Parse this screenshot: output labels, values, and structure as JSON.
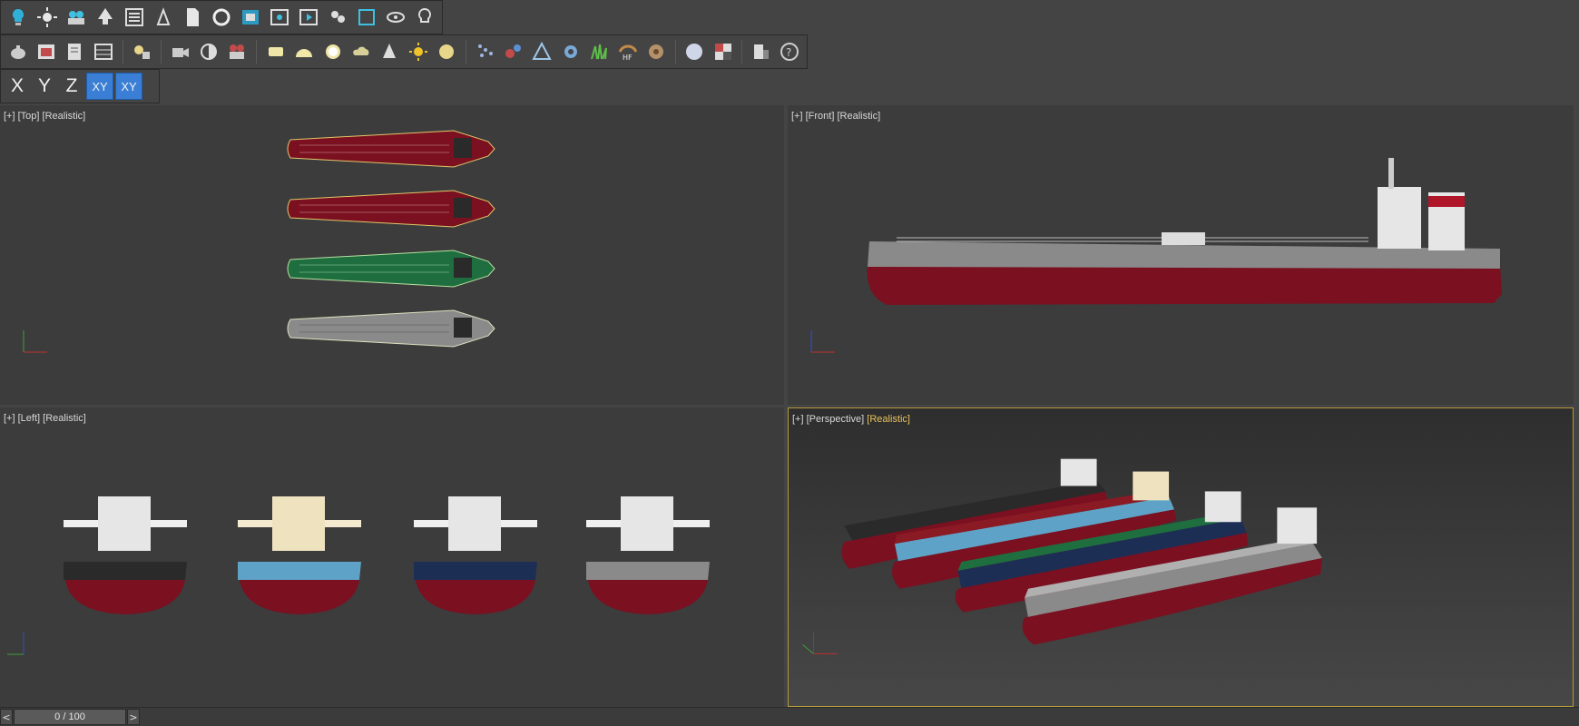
{
  "toolbar_row1": {
    "icons": [
      "light-bulb-icon",
      "sun-icon",
      "camera-group-icon",
      "tree-icon",
      "list-icon",
      "scale-icon",
      "document-icon",
      "rotate-icon",
      "box-view-icon",
      "frame-icon",
      "play-frame-icon",
      "camera-rig-icon",
      "window-icon",
      "eye-icon",
      "idea-icon"
    ]
  },
  "toolbar_row2": {
    "icons": [
      "teapot-icon",
      "render-frame-icon",
      "render-setup-icon",
      "grid-table-icon",
      "light-lister-icon",
      "video-camera-icon",
      "half-sphere-icon",
      "film-camera-icon",
      "plane-icon",
      "dome-icon",
      "sphere-light-icon",
      "cloud-icon",
      "cone-icon",
      "sun-burst-icon",
      "disc-icon",
      "particles-icon",
      "molecule-icon",
      "pyramid-icon",
      "gear-ball-icon",
      "grass-icon",
      "hf-icon",
      "shell-icon",
      "sphere-icon",
      "checker-icon",
      "settings-icon",
      "help-icon"
    ]
  },
  "axis_constraints": {
    "x": "X",
    "y": "Y",
    "z": "Z",
    "xy": "XY",
    "xy_snap": "XY"
  },
  "viewports": {
    "top": {
      "plus": "[+]",
      "name": "[Top]",
      "mode": "[Realistic]"
    },
    "front": {
      "plus": "[+]",
      "name": "[Front]",
      "mode": "[Realistic]"
    },
    "left": {
      "plus": "[+]",
      "name": "[Left]",
      "mode": "[Realistic]"
    },
    "persp": {
      "plus": "[+]",
      "name": "[Perspective]",
      "mode": "[Realistic]"
    }
  },
  "colors": {
    "accent": "#3a7fd5",
    "active_viewport_border": "#b49a3a",
    "hull_red": "#7a1020",
    "hull_green": "#1f6e3f",
    "hull_gray": "#8a8a8a",
    "hull_blue": "#5ea3c7",
    "hull_navy": "#1d2e55",
    "hull_black": "#2a2a2a"
  },
  "timeline": {
    "prev": "<",
    "frame": "0 / 100",
    "next": ">"
  }
}
